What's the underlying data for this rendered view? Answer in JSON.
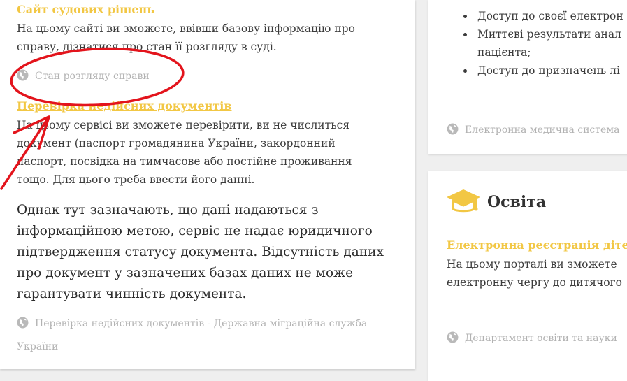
{
  "left": {
    "court": {
      "title": "Сайт судових рішень",
      "desc_line1": "На цьому сайті ви зможете, ввівши базову інформацію про",
      "desc_line2": "справу, дізнатися про стан її розгляду в суді.",
      "link": "Стан розгляду справи"
    },
    "invalid_docs": {
      "title": "Перевірка недійсних документів",
      "desc_line1": "На цьому сервісі ви зможете перевірити, ви не числиться",
      "desc_line2": "документ (паспорт громадянина України, закордонний",
      "desc_line3": "паспорт, посвідка на тимчасове або постійне проживання",
      "desc_line4": "тощо. Для цього треба ввести його данні.",
      "link_line1": "Перевірка недійсних документів - Державна міграційна служба",
      "link_line2": "України"
    },
    "note": {
      "line1": "Однак тут зазначають, що дані надаються з",
      "line2": "інформаційною метою, сервіс не надає юридичного",
      "line3": "підтвердження статусу документа. Відсутність даних",
      "line4": "про документ у зазначених базах даних не може",
      "line5": "гарантувати чинність документа."
    }
  },
  "right_top": {
    "bullets": [
      "Доступ до своєї електрон",
      "Миттєві результати анал",
      "пацієнта;",
      " Доступ до призначень лі"
    ],
    "link": "Електронна медична система"
  },
  "right_bottom": {
    "heading": "Освіта",
    "service_title": "Електронна реєстрація дітей",
    "desc_line1": "На цьому порталі ви зможете",
    "desc_line2": "електронну чергу до дитячого",
    "link": "Департамент освіти та науки"
  },
  "colors": {
    "accent_yellow": "#f2c744",
    "annotation_red": "#e3141c",
    "link_gray": "#b2b2b2"
  },
  "icons": [
    "globe-icon",
    "graduation-cap-icon"
  ]
}
